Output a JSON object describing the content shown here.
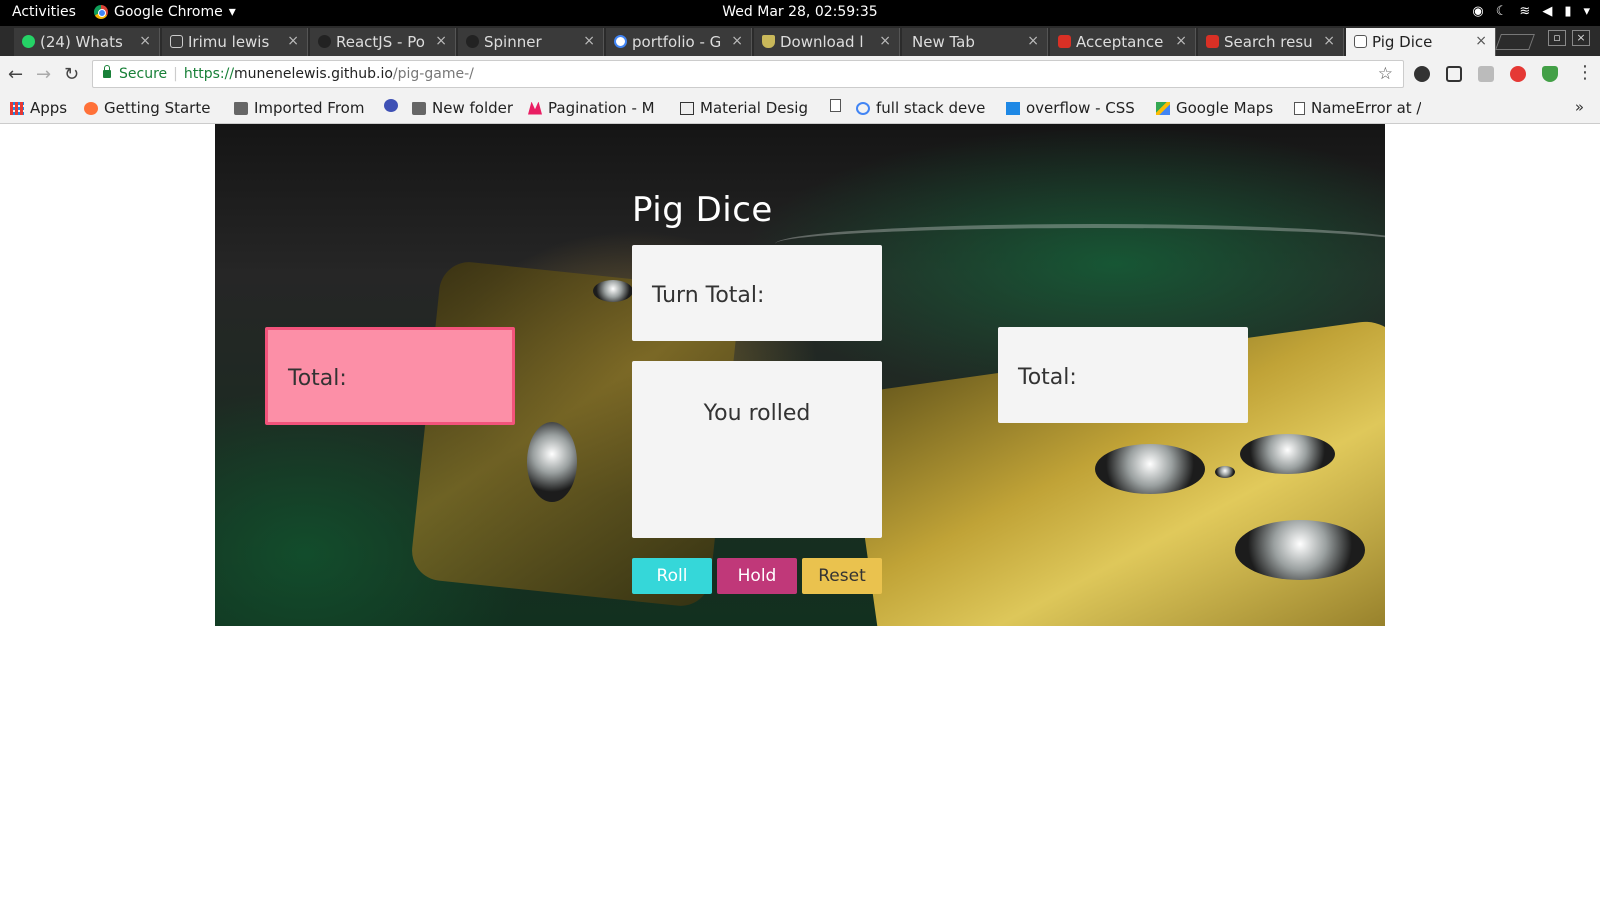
{
  "system_bar": {
    "activities": "Activities",
    "app_name": "Google Chrome",
    "clock": "Wed Mar 28, 02:59:35"
  },
  "tabs": [
    {
      "label": "(24) Whats",
      "icon": "whatsapp-icon"
    },
    {
      "label": "Irimu lewis",
      "icon": "page-icon"
    },
    {
      "label": "ReactJS - Po",
      "icon": "github-icon"
    },
    {
      "label": "Spinner",
      "icon": "github-icon"
    },
    {
      "label": "portfolio - G",
      "icon": "google-icon"
    },
    {
      "label": "Download l",
      "icon": "shield-icon"
    },
    {
      "label": "New Tab",
      "icon": ""
    },
    {
      "label": "Acceptance",
      "icon": "gmail-icon"
    },
    {
      "label": "Search resu",
      "icon": "gmail-icon"
    },
    {
      "label": "Pig Dice",
      "icon": "page-icon",
      "active": true
    }
  ],
  "address_bar": {
    "security_label": "Secure",
    "url_protocol": "https://",
    "url_host": "munenelewis.github.io",
    "url_path": "/pig-game-/"
  },
  "bookmarks": [
    {
      "label": "Apps",
      "icon": "apps-grid-icon"
    },
    {
      "label": "Getting Starte",
      "icon": "firefox-icon"
    },
    {
      "label": "Imported From",
      "icon": "folder-icon"
    },
    {
      "label": "",
      "icon": "d-logo-icon"
    },
    {
      "label": "New folder",
      "icon": "folder-icon"
    },
    {
      "label": "Pagination - M",
      "icon": "m-logo-icon"
    },
    {
      "label": "Material Desig",
      "icon": "material-icon"
    },
    {
      "label": "",
      "icon": "page-icon"
    },
    {
      "label": "full stack deve",
      "icon": "google-icon"
    },
    {
      "label": "overflow - CSS",
      "icon": "bookmark-icon"
    },
    {
      "label": "Google Maps",
      "icon": "maps-icon"
    },
    {
      "label": "NameError at /",
      "icon": "page-icon"
    }
  ],
  "bookmarks_overflow": "»",
  "game": {
    "title": "Pig Dice",
    "player1_total_label": "Total:",
    "player2_total_label": "Total:",
    "turn_total_label": "Turn Total:",
    "rolled_label": "You rolled",
    "roll_button": "Roll",
    "hold_button": "Hold",
    "reset_button": "Reset"
  },
  "colors": {
    "active_player_card": "#fc8fa7",
    "active_player_border": "#f2537b",
    "roll_button": "#35d7d9",
    "hold_button": "#c03879",
    "reset_button": "#eac24e"
  }
}
